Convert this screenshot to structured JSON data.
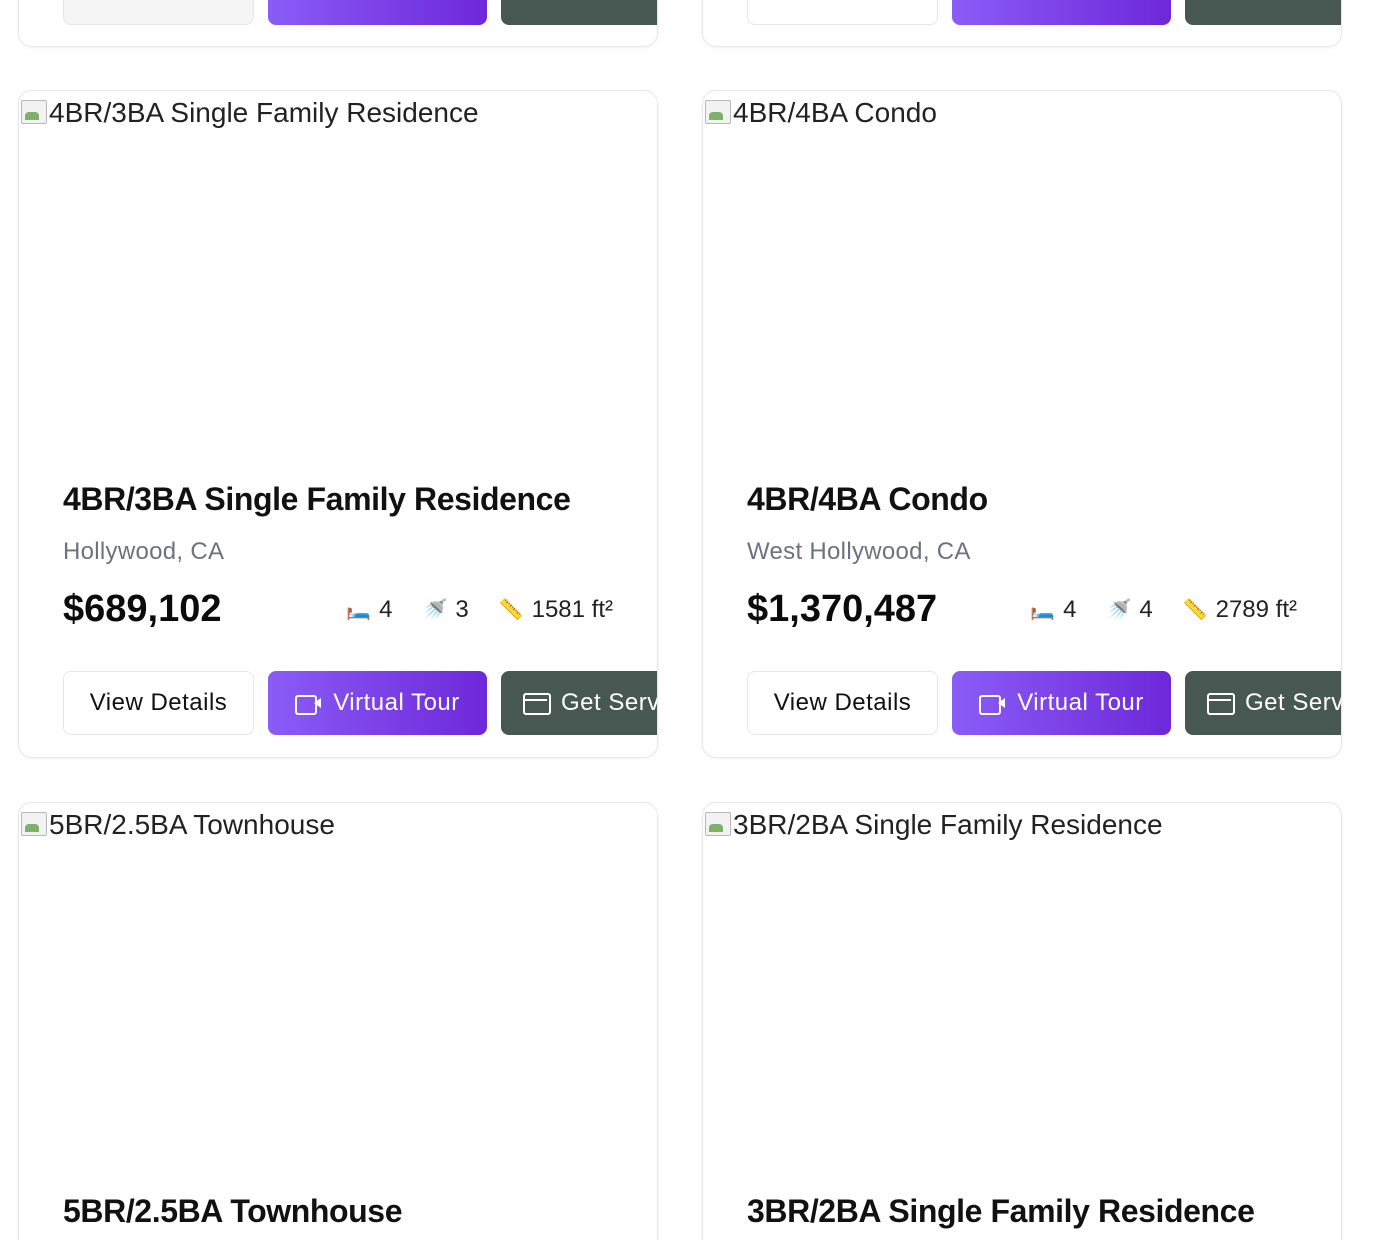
{
  "buttons": {
    "view_details": "View Details",
    "virtual_tour": "Virtual Tour",
    "get_service": "Get Serv"
  },
  "listings": [
    {
      "title": "4BR/3BA Single Family Residence",
      "image_alt": "4BR/3BA Single Family Residence",
      "location": "Hollywood, CA",
      "price": "$689,102",
      "beds": "4",
      "baths": "3",
      "sqft": "1581 ft²"
    },
    {
      "title": "4BR/4BA Condo",
      "image_alt": "4BR/4BA Condo",
      "location": "West Hollywood, CA",
      "price": "$1,370,487",
      "beds": "4",
      "baths": "4",
      "sqft": "2789 ft²"
    },
    {
      "title": "5BR/2.5BA Townhouse",
      "image_alt": "5BR/2.5BA Townhouse"
    },
    {
      "title": "3BR/2BA Single Family Residence",
      "image_alt": "3BR/2BA Single Family Residence"
    }
  ],
  "icons": {
    "bed": "bed-icon",
    "bath": "shower-icon",
    "sqft": "ruler-icon",
    "tour": "video-icon",
    "service": "credit-card-icon"
  },
  "colors": {
    "tour_gradient_start": "#8b5cf6",
    "tour_gradient_end": "#6d28d9",
    "service_button": "#475752",
    "location_text": "#6b7280"
  }
}
